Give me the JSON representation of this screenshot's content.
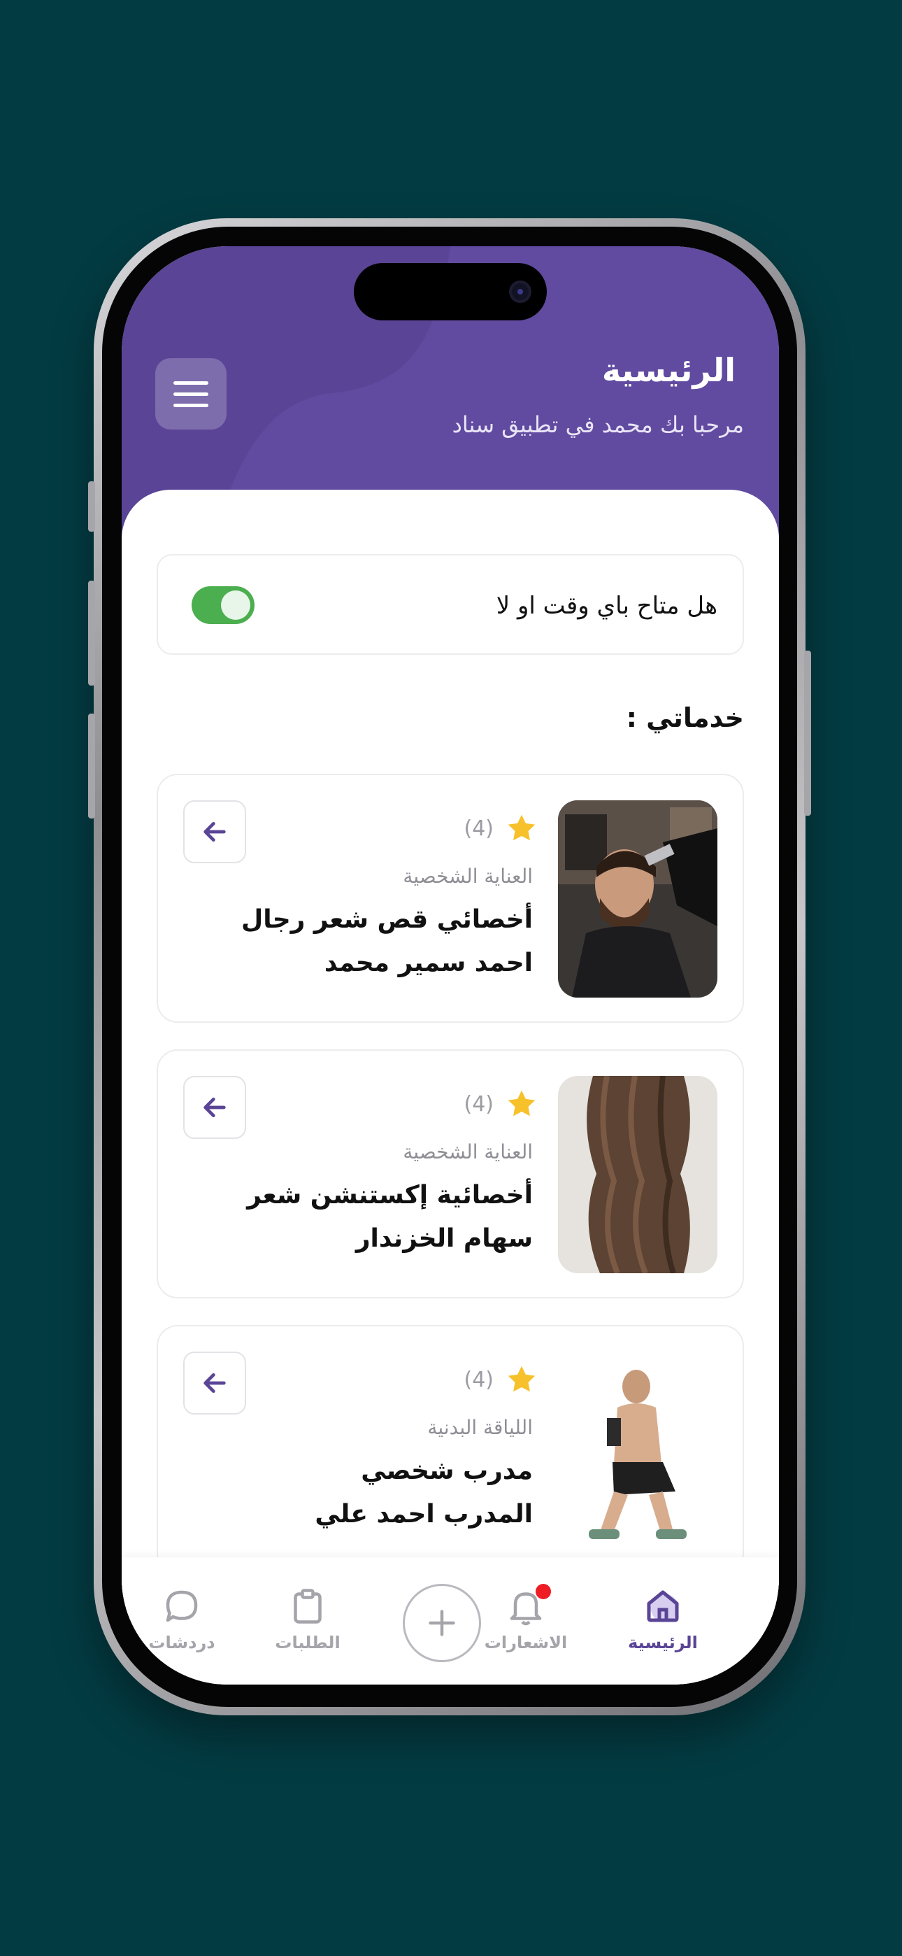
{
  "header": {
    "title": "الرئيسية",
    "subtitle": "مرحبا بك محمد في تطبيق سناد",
    "menu_icon": "hamburger-icon"
  },
  "availability": {
    "label": "هل متاح باي وقت او لا",
    "enabled": true,
    "toggle_color": "#4bae4f"
  },
  "services_section": {
    "title": "خدماتي :"
  },
  "services": [
    {
      "rating_count": "(4)",
      "category": "العناية الشخصية",
      "title": "أخصائي قص شعر رجال",
      "provider": "احمد سمير محمد",
      "image": "barber-photo"
    },
    {
      "rating_count": "(4)",
      "category": "العناية الشخصية",
      "title": "أخصائية إكستنشن شعر",
      "provider": "سهام الخزندار",
      "image": "hair-extension-photo"
    },
    {
      "rating_count": "(4)",
      "category": "اللياقة البدنية",
      "title": "مدرب شخصي",
      "provider": "المدرب احمد علي",
      "image": "fitness-trainer-photo"
    }
  ],
  "bottom_nav": {
    "home": "الرئيسية",
    "notifications": "الاشعارات",
    "orders": "الطلبات",
    "chats": "دردشات",
    "add_icon": "plus-icon"
  },
  "colors": {
    "brand": "#5a4496",
    "background": "#033b42",
    "star": "#f7c12b",
    "notification_dot": "#ee1c24"
  }
}
